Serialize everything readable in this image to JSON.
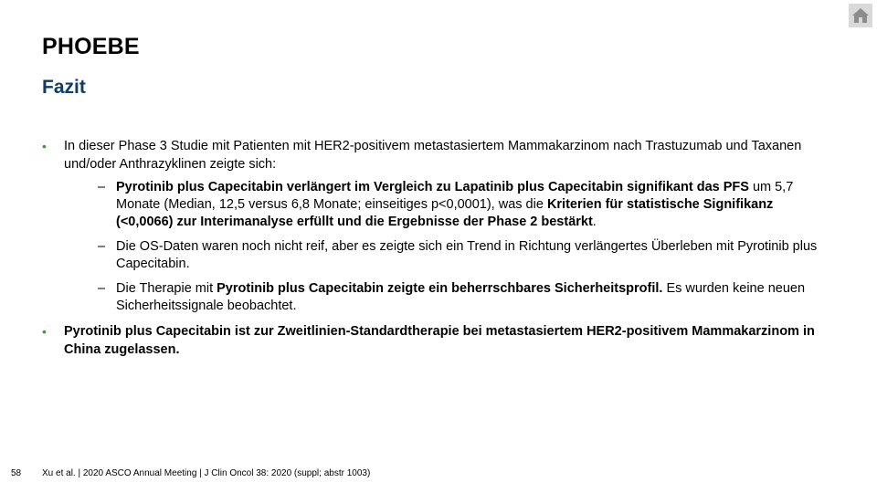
{
  "header": {
    "title": "PHOEBE",
    "subtitle": "Fazit",
    "home_icon": "home-icon"
  },
  "colors": {
    "subtitle": "#0f3d63",
    "bullet": "#3f9c35",
    "home_button_bg": "#d9d9d9"
  },
  "bullets": [
    {
      "marker": "•",
      "text": "In dieser Phase 3 Studie mit Patienten mit HER2-positivem metastasiertem Mammakarzinom nach Trastuzumab und Taxanen und/oder Anthrazyklinen zeigte sich:",
      "subs": [
        {
          "marker": "–",
          "b1": "Pyrotinib plus Capecitabin verlängert im Vergleich zu Lapatinib plus Capecitabin signifikant das PFS",
          "t1": " um 5,7 Monate (Median, 12,5 versus 6,8 Monate; einseitiges p<0,0001), was die ",
          "b2": "Kriterien für statistische Signifikanz (<0,0066) zur Interimanalyse erfüllt und die Ergebnisse der Phase 2 bestärkt",
          "t2": "."
        },
        {
          "marker": "–",
          "text": "Die OS-Daten waren noch nicht reif, aber es zeigte sich ein Trend in Richtung verlängertes Überleben mit Pyrotinib plus Capecitabin."
        },
        {
          "marker": "–",
          "t1": "Die Therapie mit ",
          "b1": "Pyrotinib plus Capecitabin zeigte ein beherrschbares Sicherheitsprofil.",
          "t2": " Es wurden keine neuen Sicherheitssignale beobachtet."
        }
      ]
    },
    {
      "marker": "•",
      "text": "Pyrotinib plus Capecitabin ist zur Zweitlinien-Standardtherapie bei metastasiertem HER2-positivem Mammakarzinom in China zugelassen."
    }
  ],
  "footer": {
    "page_number": "58",
    "citation": "Xu et al. | 2020 ASCO Annual Meeting | J Clin Oncol 38: 2020 (suppl; abstr 1003)"
  }
}
